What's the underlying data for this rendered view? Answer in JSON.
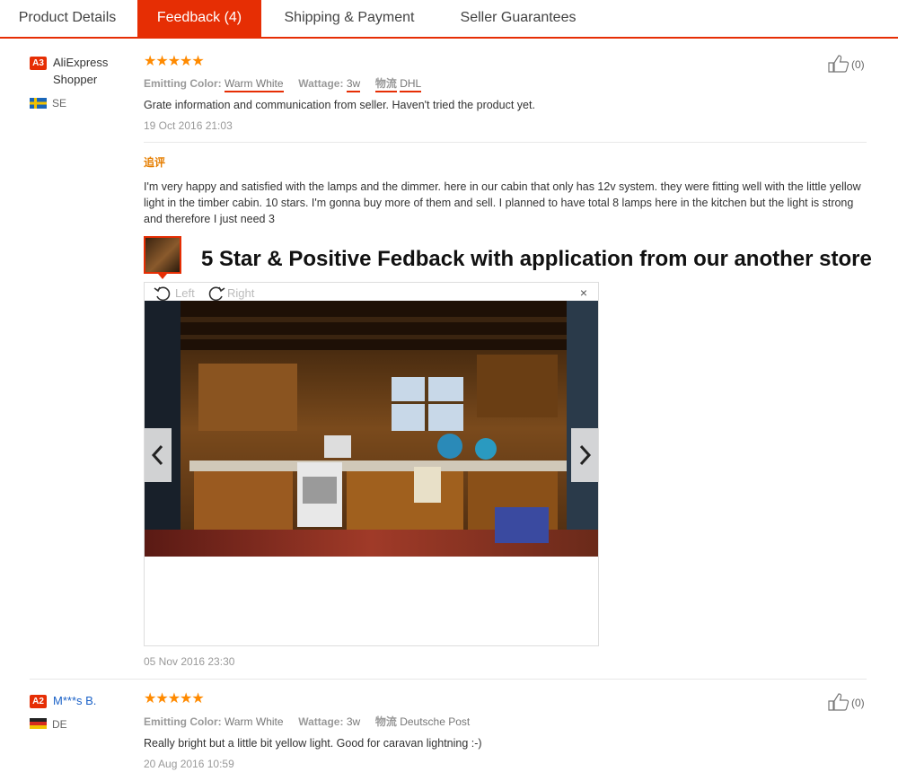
{
  "tabs": [
    {
      "label": "Product Details",
      "active": false
    },
    {
      "label": "Feedback (4)",
      "active": true
    },
    {
      "label": "Shipping & Payment",
      "active": false
    },
    {
      "label": "Seller Guarantees",
      "active": false
    }
  ],
  "colors": {
    "accent": "#e62e04",
    "star": "#ff8a00",
    "link": "#1a61c7"
  },
  "reviews": [
    {
      "level": "A3",
      "user": "AliExpress Shopper",
      "country": "SE",
      "stars": "★★★★★",
      "rating": 5,
      "attr_color_label": "Emitting Color:",
      "attr_color": "Warm White",
      "attr_watt_label": "Wattage:",
      "attr_watt": "3w",
      "attr_ship_label": "物流",
      "attr_ship": "DHL",
      "text": "Grate information and communication from seller. Haven't tried the product yet.",
      "date": "19 Oct 2016 21:03",
      "likes": "(0)",
      "append_label": "追评",
      "append_text": "I'm very happy and satisfied with the lamps and the dimmer. here in our cabin that only has 12v system. they were fitting well with the little yellow light in the timber cabin. 10 stars. I'm gonna buy more of them and sell. I planned to have total 8 lamps here in the kitchen but the light is strong and therefore I just need 3",
      "append_date": "05 Nov 2016 23:30"
    },
    {
      "level": "A2",
      "user": "M***s B.",
      "country": "DE",
      "stars": "★★★★★",
      "rating": 5,
      "attr_color_label": "Emitting Color:",
      "attr_color": "Warm White",
      "attr_watt_label": "Wattage:",
      "attr_watt": "3w",
      "attr_ship_label": "物流",
      "attr_ship": "Deutsche Post",
      "text": "Really bright but a little bit yellow light. Good for caravan lightning :-)",
      "date": "20 Aug 2016 10:59",
      "likes": "(0)"
    }
  ],
  "caption": "5 Star & Positive Fedback with application from our another store",
  "viewer": {
    "rotate_left": "Left",
    "rotate_right": "Right",
    "close": "×"
  }
}
